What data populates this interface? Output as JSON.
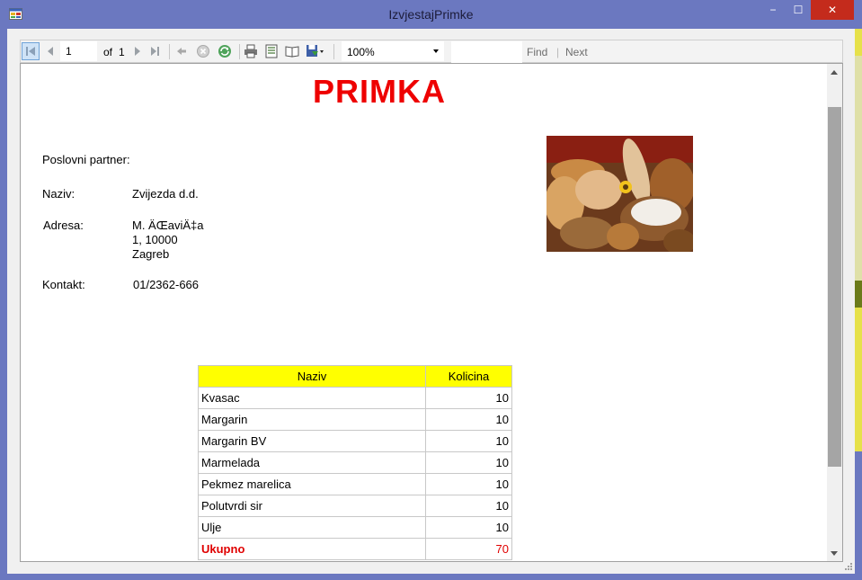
{
  "window": {
    "title": "IzvjestajPrimke",
    "minimize_glyph": "−",
    "maximize_glyph": "☐",
    "close_glyph": "✕"
  },
  "toolbar": {
    "page_current": "1",
    "page_of_label": "of",
    "page_total": "1",
    "zoom": "100%",
    "find_label": "Find",
    "separator": "|",
    "next_label": "Next",
    "icons": [
      "first-page-icon",
      "previous-page-icon",
      "next-page-icon",
      "last-page-icon",
      "back-icon",
      "stop-icon",
      "refresh-icon",
      "print-icon",
      "print-layout-icon",
      "page-setup-icon",
      "export-icon"
    ]
  },
  "report": {
    "title": "PRIMKA",
    "partner_label": "Poslovni partner:",
    "name_label": "Naziv:",
    "name_value": "Zvijezda d.d.",
    "address_label": "Adresa:",
    "address_line1": "M. ÄŒaviÄ‡a",
    "address_line2": "1, 10000",
    "address_line3": "Zagreb",
    "contact_label": "Kontakt:",
    "contact_value": "01/2362-666",
    "table": {
      "headers": [
        "Naziv",
        "Kolicina"
      ],
      "rows": [
        {
          "name": "Kvasac",
          "qty": "10"
        },
        {
          "name": "Margarin",
          "qty": "10"
        },
        {
          "name": "Margarin BV",
          "qty": "10"
        },
        {
          "name": "Marmelada",
          "qty": "10"
        },
        {
          "name": "Pekmez marelica",
          "qty": "10"
        },
        {
          "name": "Polutvrdi sir",
          "qty": "10"
        },
        {
          "name": "Ulje",
          "qty": "10"
        }
      ],
      "total_label": "Ukupno",
      "total_value": "70"
    }
  },
  "colors": {
    "frame": "#6b78c0",
    "title_red": "#ee0000",
    "header_yellow": "#ffff00",
    "close_red": "#c42b1c"
  }
}
